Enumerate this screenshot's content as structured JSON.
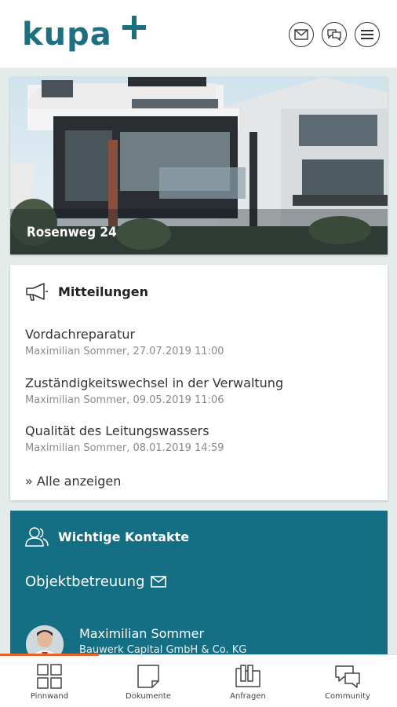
{
  "app": {
    "logo_text": "kupa"
  },
  "header": {
    "icons": [
      "mail-icon",
      "chat-icon",
      "menu-icon"
    ]
  },
  "hero": {
    "title": "Rosenweg 24"
  },
  "messages": {
    "title": "Mitteilungen",
    "items": [
      {
        "title": "Vordachreparatur",
        "meta": "Maximilian Sommer, 27.07.2019 11:00"
      },
      {
        "title": "Zuständigkeitswechsel in der Verwaltung",
        "meta": "Maximilian Sommer, 09.05.2019 11:06"
      },
      {
        "title": "Qualität des Leitungswassers",
        "meta": "Maximilian Sommer, 08.01.2019 14:59"
      }
    ],
    "show_all": "» Alle anzeigen"
  },
  "contacts": {
    "title": "Wichtige Kontakte",
    "subtitle": "Objektbetreuung",
    "person": {
      "name": "Maximilian Sommer",
      "org": "Bauwerk Capital GmbH & Co. KG"
    }
  },
  "tabs": [
    {
      "label": "Pinnwand",
      "icon": "grid-icon"
    },
    {
      "label": "Dokumente",
      "icon": "document-icon"
    },
    {
      "label": "Anfragen",
      "icon": "inquiry-icon"
    },
    {
      "label": "Community",
      "icon": "community-icon"
    }
  ],
  "colors": {
    "brand": "#1d7080",
    "contacts_bg": "#146f85",
    "accent": "#e4652e"
  }
}
